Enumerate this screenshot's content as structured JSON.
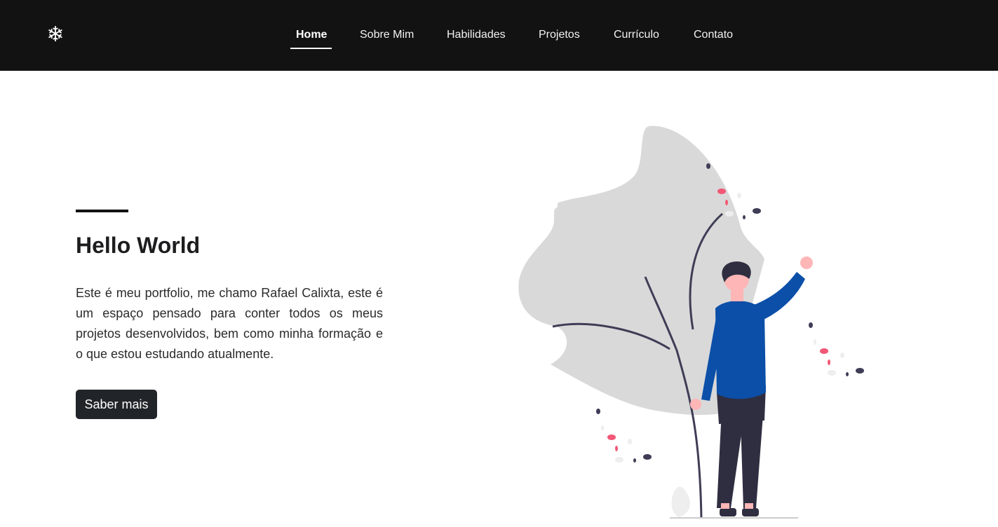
{
  "header": {
    "logo_icon": "snowflake-icon",
    "logo_glyph": "❄",
    "nav": [
      {
        "label": "Home",
        "active": true
      },
      {
        "label": "Sobre Mim",
        "active": false
      },
      {
        "label": "Habilidades",
        "active": false
      },
      {
        "label": "Projetos",
        "active": false
      },
      {
        "label": "Currículo",
        "active": false
      },
      {
        "label": "Contato",
        "active": false
      }
    ]
  },
  "hero": {
    "title": "Hello World",
    "description": "Este é meu portfolio, me chamo Rafael Calixta, este é um espaço pensado para conter todos os meus projetos desenvolvidos, bem como minha formação e o que estou estudando atualmente.",
    "button_label": "Saber mais",
    "illustration": "person-waving-with-plant-illustration"
  },
  "colors": {
    "navbar_bg": "#121212",
    "button_bg": "#212529",
    "sweater": "#0b4fa8",
    "pants": "#2f2e41",
    "skin": "#ffb6b6",
    "accent_pink": "#f25876",
    "leaf": "#d9d9d9"
  }
}
